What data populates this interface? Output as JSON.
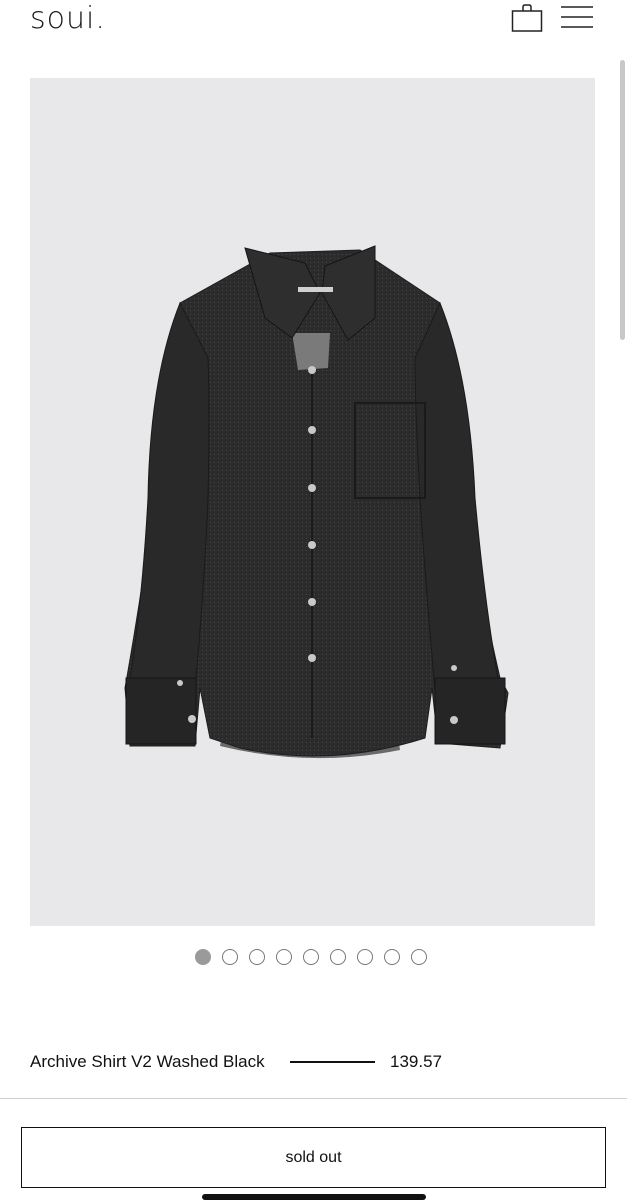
{
  "header": {
    "logo": "soui.",
    "bag_icon": "shopping-bag-icon",
    "menu_icon": "hamburger-menu-icon"
  },
  "gallery": {
    "background_color": "#e8e8ea",
    "garment_color": "#2b2a2a",
    "image_subject": "shirt-image",
    "slide_count": 9,
    "active_slide": 1
  },
  "product": {
    "name": "Archive Shirt V2 Washed Black",
    "price": "139.57"
  },
  "cta": {
    "label": "sold out"
  }
}
